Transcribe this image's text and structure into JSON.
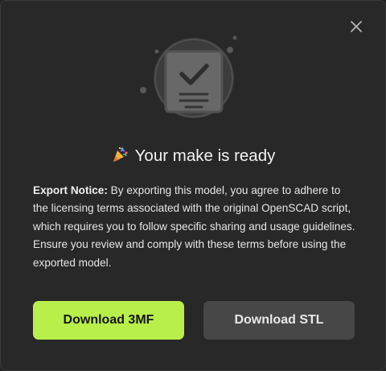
{
  "dialog": {
    "close_icon": "close-icon",
    "illustration_icon": "clipboard-check-icon",
    "title_emoji": "party-popper-icon",
    "title": "Your make is ready",
    "notice_label": "Export Notice:",
    "notice_text": " By exporting this model, you agree to adhere to the licensing terms associated with the original OpenSCAD script, which requires you to follow specific sharing and usage guidelines. Ensure you review and comply with these terms before using the exported model.",
    "primary_button": "Download 3MF",
    "secondary_button": "Download STL"
  },
  "colors": {
    "background": "#282828",
    "accent": "#b8ef4b",
    "secondary_button": "#474747",
    "text": "#ececec"
  }
}
